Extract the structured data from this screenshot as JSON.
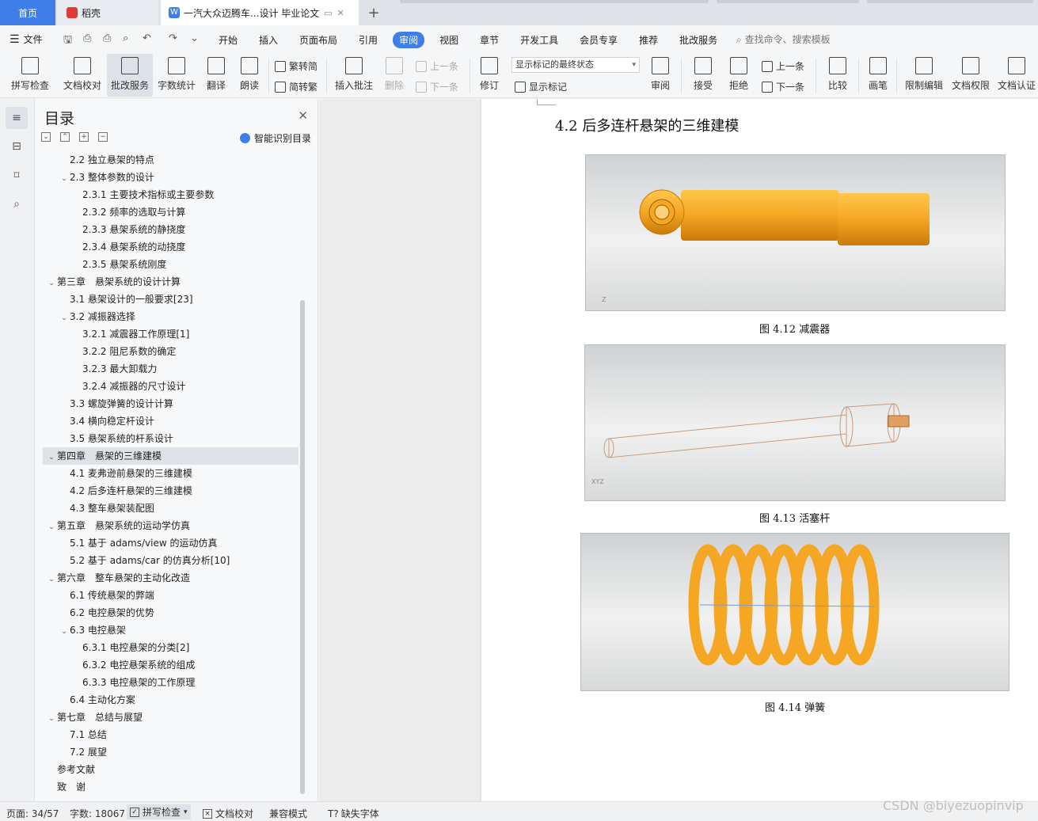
{
  "tabs": {
    "home": "首页",
    "daoke": "稻壳",
    "doc_title": "一汽大众迈腾车...设计 毕业论文",
    "add": "+"
  },
  "menu": {
    "file": "文件",
    "items": [
      "开始",
      "插入",
      "页面布局",
      "引用",
      "审阅",
      "视图",
      "章节",
      "开发工具",
      "会员专享",
      "推荐",
      "批改服务"
    ],
    "active": "审阅",
    "search": "查找命令、搜索模板"
  },
  "ribbon": {
    "spellcheck": "拼写检查",
    "proofread": "文档校对",
    "review_service": "批改服务",
    "word_count": "字数统计",
    "translate": "翻译",
    "read_aloud": "朗读",
    "trad_to_simp": "繁转简",
    "simp_to_trad": "简转繁",
    "insert_comment": "插入批注",
    "delete": "删除",
    "prev": "上一条",
    "next": "下一条",
    "track_changes": "修订",
    "markup_select": "显示标记的最终状态",
    "show_markup": "显示标记",
    "review": "审阅",
    "accept": "接受",
    "reject": "拒绝",
    "prev2": "上一条",
    "next2": "下一条",
    "compare": "比较",
    "ink": "画笔",
    "restrict_edit": "限制编辑",
    "doc_permission": "文档权限",
    "doc_certify": "文档认证"
  },
  "outline": {
    "title": "目录",
    "smart": "智能识别目录",
    "items": [
      {
        "text": "2.2 独立悬架的特点",
        "level": 2,
        "toggle": ""
      },
      {
        "text": "2.3 整体参数的设计",
        "level": 2,
        "toggle": "v"
      },
      {
        "text": "2.3.1 主要技术指标或主要参数",
        "level": 3,
        "toggle": ""
      },
      {
        "text": "2.3.2 频率的选取与计算",
        "level": 3,
        "toggle": ""
      },
      {
        "text": "2.3.3 悬架系统的静挠度",
        "level": 3,
        "toggle": ""
      },
      {
        "text": "2.3.4 悬架系统的动挠度",
        "level": 3,
        "toggle": ""
      },
      {
        "text": "2.3.5 悬架系统刚度",
        "level": 3,
        "toggle": ""
      },
      {
        "text": "第三章　悬架系统的设计计算",
        "level": 1,
        "toggle": "v"
      },
      {
        "text": "3.1 悬架设计的一般要求[23]",
        "level": 2,
        "toggle": ""
      },
      {
        "text": "3.2 减振器选择",
        "level": 2,
        "toggle": "v"
      },
      {
        "text": "3.2.1 减震器工作原理[1]",
        "level": 3,
        "toggle": ""
      },
      {
        "text": "3.2.2 阻尼系数的确定",
        "level": 3,
        "toggle": ""
      },
      {
        "text": "3.2.3 最大卸载力",
        "level": 3,
        "toggle": ""
      },
      {
        "text": "3.2.4 减振器的尺寸设计",
        "level": 3,
        "toggle": ""
      },
      {
        "text": "3.3 螺旋弹簧的设计计算",
        "level": 2,
        "toggle": ""
      },
      {
        "text": "3.4 横向稳定杆设计",
        "level": 2,
        "toggle": ""
      },
      {
        "text": "3.5 悬架系统的杆系设计",
        "level": 2,
        "toggle": ""
      },
      {
        "text": "第四章　悬架的三维建模",
        "level": 1,
        "toggle": "v",
        "selected": true
      },
      {
        "text": "4.1 麦弗逊前悬架的三维建模",
        "level": 2,
        "toggle": ""
      },
      {
        "text": "4.2 后多连杆悬架的三维建模",
        "level": 2,
        "toggle": ""
      },
      {
        "text": "4.3 整车悬架装配图",
        "level": 2,
        "toggle": ""
      },
      {
        "text": "第五章　悬架系统的运动学仿真",
        "level": 1,
        "toggle": "v"
      },
      {
        "text": "5.1 基于 adams/view 的运动仿真",
        "level": 2,
        "toggle": ""
      },
      {
        "text": "5.2 基于 adams/car 的仿真分析[10]",
        "level": 2,
        "toggle": ""
      },
      {
        "text": "第六章　整车悬架的主动化改造",
        "level": 1,
        "toggle": "v"
      },
      {
        "text": "6.1 传统悬架的弊端",
        "level": 2,
        "toggle": ""
      },
      {
        "text": "6.2 电控悬架的优势",
        "level": 2,
        "toggle": ""
      },
      {
        "text": "6.3 电控悬架",
        "level": 2,
        "toggle": "v"
      },
      {
        "text": "6.3.1 电控悬架的分类[2]",
        "level": 3,
        "toggle": ""
      },
      {
        "text": "6.3.2 电控悬架系统的组成",
        "level": 3,
        "toggle": ""
      },
      {
        "text": "6.3.3 电控悬架的工作原理",
        "level": 3,
        "toggle": ""
      },
      {
        "text": "6.4 主动化方案",
        "level": 2,
        "toggle": ""
      },
      {
        "text": "第七章　总结与展望",
        "level": 1,
        "toggle": "v"
      },
      {
        "text": "7.1 总结",
        "level": 2,
        "toggle": ""
      },
      {
        "text": "7.2 展望",
        "level": 2,
        "toggle": ""
      },
      {
        "text": "参考文献",
        "level": 1,
        "toggle": ""
      },
      {
        "text": "致　谢",
        "level": 1,
        "toggle": ""
      }
    ]
  },
  "document": {
    "heading": "4.2 后多连杆悬架的三维建模",
    "figures": [
      {
        "caption": "图 4.12 减震器"
      },
      {
        "caption": "图 4.13 活塞杆"
      },
      {
        "caption": "图 4.14 弹簧"
      }
    ]
  },
  "status": {
    "page": "页面: 34/57",
    "words": "字数: 18067",
    "spellcheck": "拼写检查",
    "proofread": "文档校对",
    "compat": "兼容模式",
    "missing_font": "缺失字体"
  },
  "watermark": "CSDN @biyezuopinvip",
  "colors": {
    "accent": "#3f7ee8",
    "part_orange": "#f5a623"
  }
}
